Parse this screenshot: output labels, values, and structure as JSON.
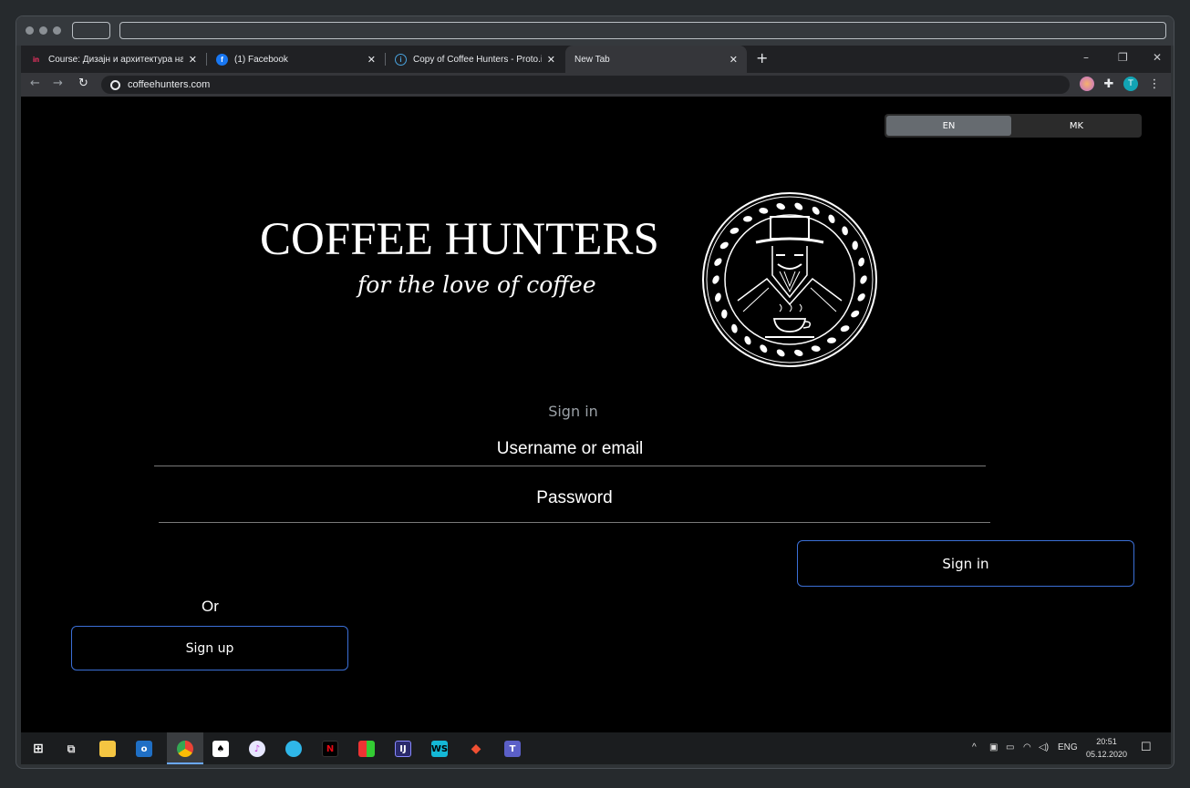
{
  "browser": {
    "tabs": [
      {
        "title": "Course: Дизајн и архитектура на",
        "favicon": "invision-icon",
        "color": "#f36"
      },
      {
        "title": "(1) Facebook",
        "favicon": "facebook-icon",
        "color": "#1877f2"
      },
      {
        "title": "Copy of Coffee Hunters - Proto.io",
        "favicon": "info-icon",
        "color": "#4aa3df"
      },
      {
        "title": "New Tab",
        "favicon": "",
        "color": ""
      }
    ],
    "new_tab_symbol": "+",
    "url": "coffeehunters.com",
    "profile_initial": "T",
    "window_controls": {
      "minimize": "–",
      "restore": "❐",
      "close": "✕"
    }
  },
  "language": {
    "options": [
      "EN",
      "MK"
    ],
    "selected": "EN"
  },
  "brand": {
    "name": "COFFEE HUNTERS",
    "tagline": "for the love of coffee"
  },
  "form": {
    "title": "Sign in",
    "username_placeholder": "Username or email",
    "password_placeholder": "Password",
    "signin_button": "Sign in",
    "or_text": "Or",
    "signup_button": "Sign up"
  },
  "taskbar": {
    "apps": [
      "windows-start-icon",
      "task-view-icon",
      "file-explorer-icon",
      "outlook-icon",
      "chrome-icon",
      "solitaire-icon",
      "itunes-icon",
      "edge-icon",
      "netflix-icon",
      "mosaic-icon",
      "jetbrains-icon",
      "webstorm-icon",
      "git-icon",
      "teams-icon"
    ],
    "language": "ENG",
    "time": "20:51",
    "date": "05.12.2020"
  }
}
